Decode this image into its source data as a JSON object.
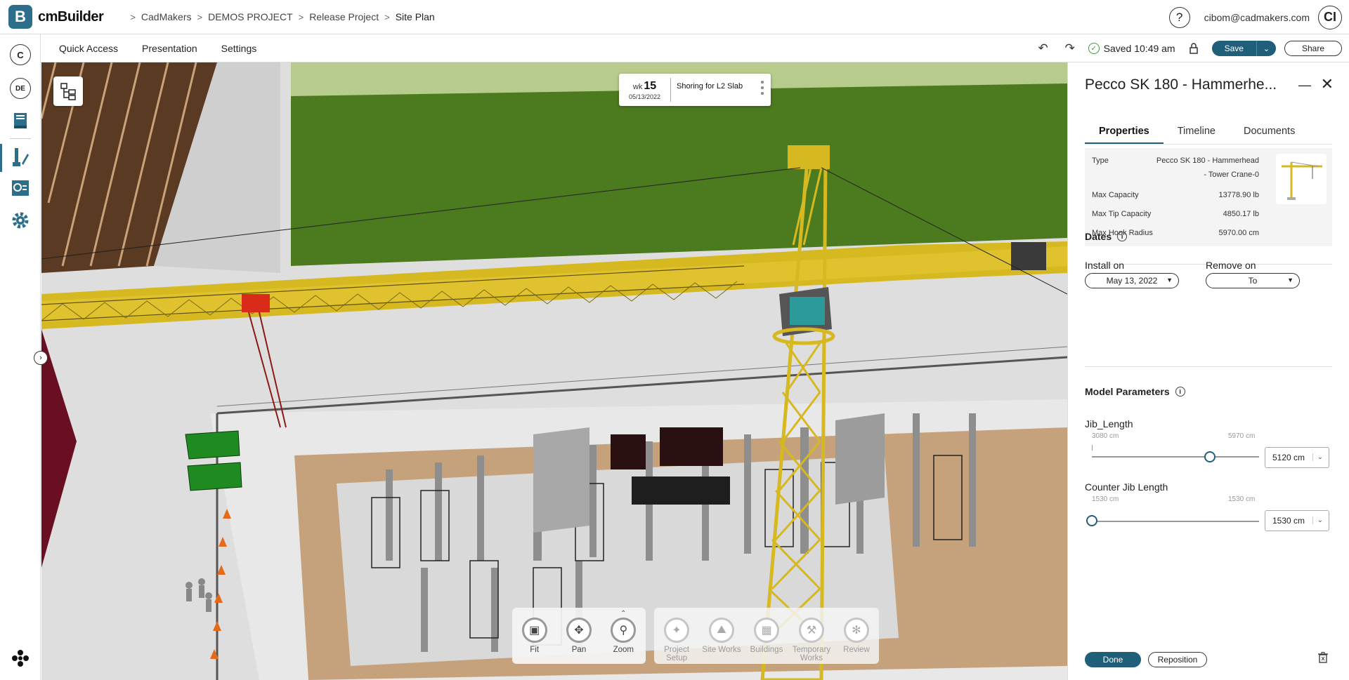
{
  "app": {
    "logo_letter": "B",
    "name": "cmBuilder"
  },
  "breadcrumb": [
    "CadMakers",
    "DEMOS PROJECT",
    "Release Project",
    "Site Plan"
  ],
  "user": {
    "help": "?",
    "email": "cibom@cadmakers.com",
    "initials": "CI"
  },
  "rail": {
    "top_circle": "C",
    "user_circle": "DE"
  },
  "toolbar": {
    "menus": [
      "Quick Access",
      "Presentation",
      "Settings"
    ],
    "saved_text": "Saved 10:49 am",
    "save_label": "Save",
    "share_label": "Share"
  },
  "week_card": {
    "wk_label": "wk",
    "wk_num": "15",
    "date": "05/13/2022",
    "task": "Shoring for L2 Slab"
  },
  "view_tools": [
    {
      "label": "Fit",
      "icon": "fit-icon"
    },
    {
      "label": "Pan",
      "icon": "pan-icon"
    },
    {
      "label": "Zoom",
      "icon": "zoom-icon"
    }
  ],
  "mode_tools": [
    {
      "label": "Project Setup",
      "icon": "project-setup-icon"
    },
    {
      "label": "Site Works",
      "icon": "site-works-icon"
    },
    {
      "label": "Buildings",
      "icon": "buildings-icon"
    },
    {
      "label": "Temporary Works",
      "icon": "temporary-works-icon"
    },
    {
      "label": "Review",
      "icon": "review-icon"
    }
  ],
  "panel": {
    "title": "Pecco SK 180 - Hammerhe...",
    "tabs": [
      "Properties",
      "Timeline",
      "Documents"
    ],
    "properties": [
      {
        "label": "Type",
        "value_line1": "Pecco SK 180 - Hammerhead",
        "value_line2": "- Tower Crane-0"
      },
      {
        "label": "Max Capacity",
        "value": "13778.90 lb"
      },
      {
        "label": "Max Tip Capacity",
        "value": "4850.17 lb"
      },
      {
        "label": "Max Hook Radius",
        "value": "5970.00 cm"
      }
    ],
    "dates": {
      "title": "Dates",
      "install_label": "Install on",
      "install_value": "May 13, 2022",
      "remove_label": "Remove on",
      "remove_value": "To"
    },
    "model_params": {
      "title": "Model Parameters",
      "params": [
        {
          "name": "Jib_Length",
          "min": "3080 cm",
          "max": "5970 cm",
          "value": "5120 cm",
          "fraction": 0.706
        },
        {
          "name": "Counter Jib Length",
          "min": "1530 cm",
          "max": "1530 cm",
          "value": "1530 cm",
          "fraction": 0
        }
      ]
    },
    "done_label": "Done",
    "reposition_label": "Reposition"
  },
  "colors": {
    "accent": "#1f5f7a",
    "crane_yellow": "#e0c41c",
    "grass": "#4c7a1e"
  }
}
